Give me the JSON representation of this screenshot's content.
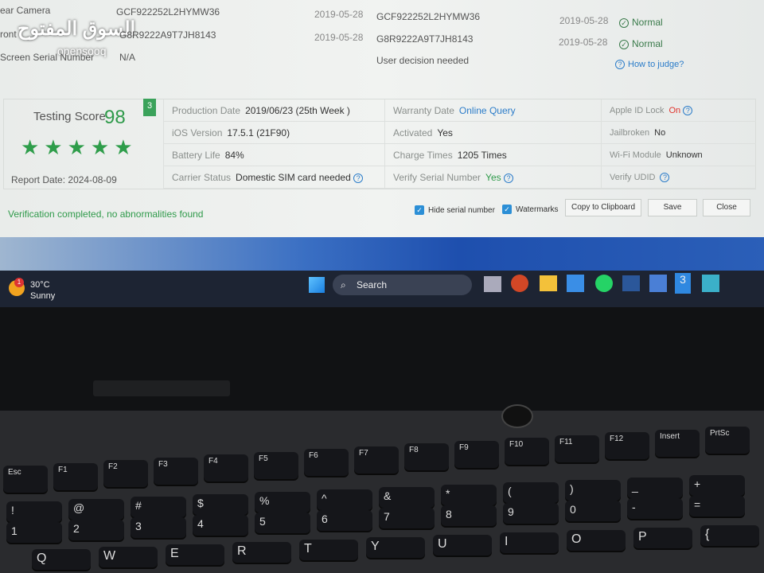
{
  "table": [
    {
      "label": "ear Camera",
      "value": "GCF922252L2HYMW36",
      "date": "2019-05-28",
      "serial": "GCF922252L2HYMW36",
      "date2": "2019-05-28",
      "status": "Normal"
    },
    {
      "label": "ront",
      "value": "G8R9222A9T7JH8143",
      "date": "2019-05-28",
      "serial": "G8R9222A9T7JH8143",
      "date2": "2019-05-28",
      "status": "Normal"
    },
    {
      "label": "Screen Serial Number",
      "value": "N/A",
      "date": "",
      "serial": "User decision needed",
      "date2": "",
      "status": "How to judge?"
    }
  ],
  "score": {
    "label": "Testing Score",
    "value": "98",
    "badge": "3",
    "stars": 5,
    "report_label": "Report Date:",
    "report_date": "2024-08-09"
  },
  "info": {
    "production_date": {
      "k": "Production Date",
      "v": "2019/06/23 (25th Week )"
    },
    "ios": {
      "k": "iOS Version",
      "v": "17.5.1 (21F90)"
    },
    "battery": {
      "k": "Battery Life",
      "v": "84%"
    },
    "carrier": {
      "k": "Carrier Status",
      "v": "Domestic SIM card needed"
    },
    "warranty": {
      "k": "Warranty Date",
      "v": "Online Query"
    },
    "activated": {
      "k": "Activated",
      "v": "Yes"
    },
    "charge": {
      "k": "Charge Times",
      "v": "1205 Times"
    },
    "verify_serial": {
      "k": "Verify Serial Number",
      "v": "Yes"
    },
    "appleid": {
      "k": "Apple ID Lock",
      "v": "On"
    },
    "jailbroken": {
      "k": "Jailbroken",
      "v": "No"
    },
    "wifi": {
      "k": "Wi-Fi Module",
      "v": "Unknown"
    },
    "udid": {
      "k": "Verify UDID",
      "v": ""
    }
  },
  "footer": {
    "status": "Verification completed, no abnormalities found",
    "hide_serial": "Hide serial number",
    "watermarks": "Watermarks",
    "copy": "Copy to Clipboard",
    "save": "Save",
    "close": "Close"
  },
  "watermark": {
    "arabic": "السوق المفتوح",
    "latin": "opensooq"
  },
  "taskbar": {
    "temp": "30°C",
    "weather": "Sunny",
    "search": "Search",
    "badge": "1"
  },
  "keys": {
    "row0": [
      "Esc",
      "F1",
      "F2",
      "F3",
      "F4",
      "F5",
      "F6",
      "F7",
      "F8",
      "F9",
      "F10",
      "F11",
      "F12",
      "Insert",
      "PrtSc"
    ],
    "row1": [
      "!",
      "@",
      "#",
      "$",
      "%",
      "^",
      "&",
      "*",
      "(",
      ")",
      "_",
      "+"
    ],
    "row1b": [
      "1",
      "2",
      "3",
      "4",
      "5",
      "6",
      "7",
      "8",
      "9",
      "0",
      "-",
      "="
    ],
    "row2": [
      "Q",
      "W",
      "E",
      "R",
      "T",
      "Y",
      "U",
      "I",
      "O",
      "P",
      "{"
    ]
  }
}
